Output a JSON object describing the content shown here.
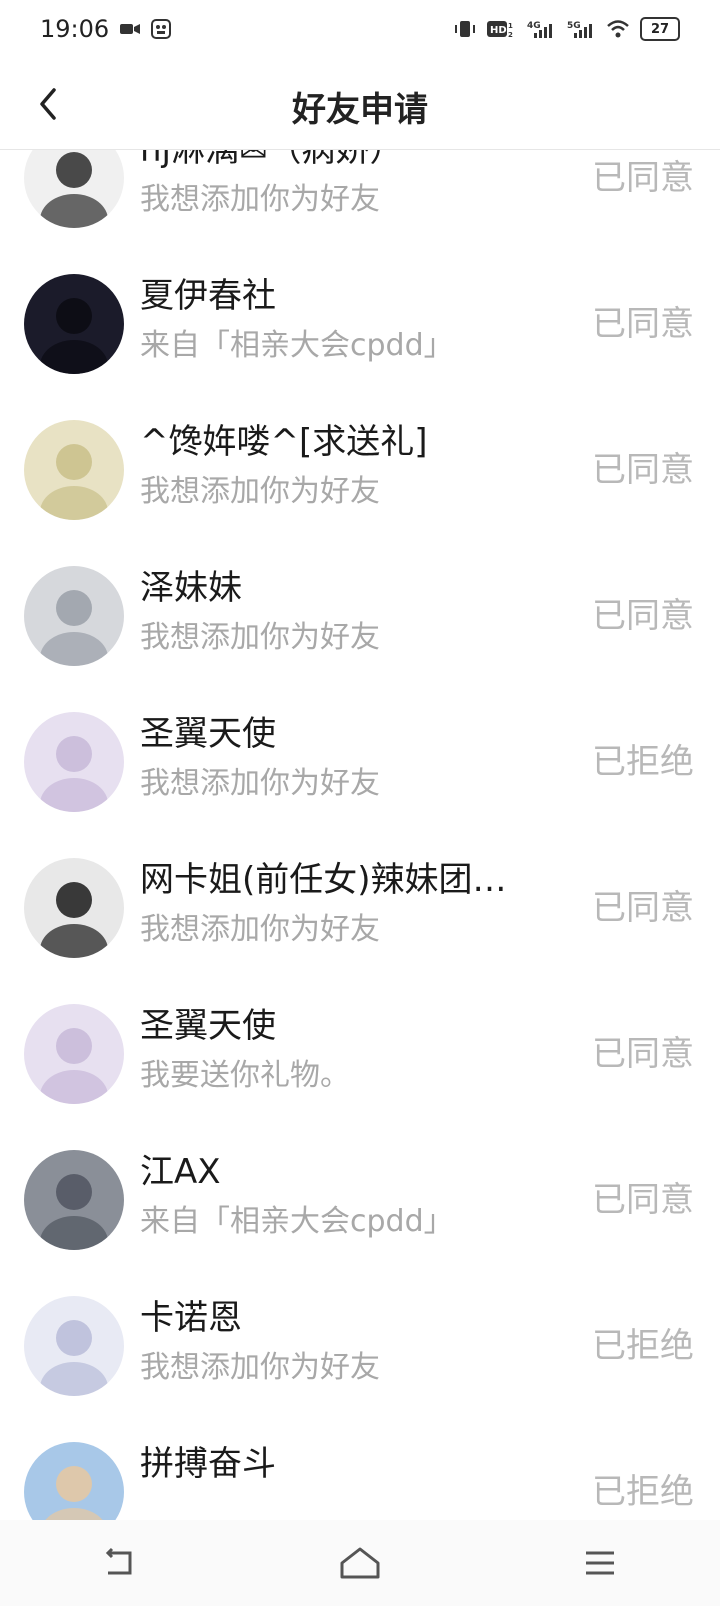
{
  "status_bar": {
    "time": "19:06",
    "left_icons": [
      "video-icon",
      "app-icon"
    ],
    "right_icons": [
      "vibrate-icon",
      "hd-icon",
      "4g-signal-icon",
      "5g-signal-icon",
      "wifi-icon"
    ],
    "battery": "27"
  },
  "header": {
    "title": "好友申请",
    "back_icon": "chevron-left-icon"
  },
  "requests": [
    {
      "name": "hj淋漓✉（病娇）",
      "message": "我想添加你为好友",
      "status": "已同意",
      "avatar_color": "#2b2b2b",
      "avatar_bg": "#f0f0f0"
    },
    {
      "name": "夏伊春社",
      "message": "来自「相亲大会cpdd」",
      "status": "已同意",
      "avatar_color": "#0a0a12",
      "avatar_bg": "#1b1b2a"
    },
    {
      "name": "^馋姩喽^[求送礼]",
      "message": "我想添加你为好友",
      "status": "已同意",
      "avatar_color": "#c9c08a",
      "avatar_bg": "#e8e2c4"
    },
    {
      "name": "泽妹妹",
      "message": "我想添加你为好友",
      "status": "已同意",
      "avatar_color": "#9aa0a8",
      "avatar_bg": "#d6d8dc"
    },
    {
      "name": "圣翼天使",
      "message": "我想添加你为好友",
      "status": "已拒绝",
      "avatar_color": "#c7b8d8",
      "avatar_bg": "#e7e0f0"
    },
    {
      "name": "网卡姐(前任女)辣妹团…",
      "message": "我想添加你为好友",
      "status": "已同意",
      "avatar_color": "#1a1a1a",
      "avatar_bg": "#e8e8e8"
    },
    {
      "name": "圣翼天使",
      "message": "我要送你礼物。",
      "status": "已同意",
      "avatar_color": "#c7b8d8",
      "avatar_bg": "#e7e0f0"
    },
    {
      "name": "江AX",
      "message": "来自「相亲大会cpdd」",
      "status": "已同意",
      "avatar_color": "#505560",
      "avatar_bg": "#8a8f98"
    },
    {
      "name": "卡诺恩",
      "message": "我想添加你为好友",
      "status": "已拒绝",
      "avatar_color": "#b8bcd8",
      "avatar_bg": "#e8eaf4"
    },
    {
      "name": "拼搏奋斗",
      "message": "",
      "status": "已拒绝",
      "avatar_color": "#e8c8a0",
      "avatar_bg": "#a8c8e8"
    }
  ],
  "nav_bar": {
    "icons": [
      "back-nav-icon",
      "home-nav-icon",
      "menu-nav-icon"
    ]
  }
}
